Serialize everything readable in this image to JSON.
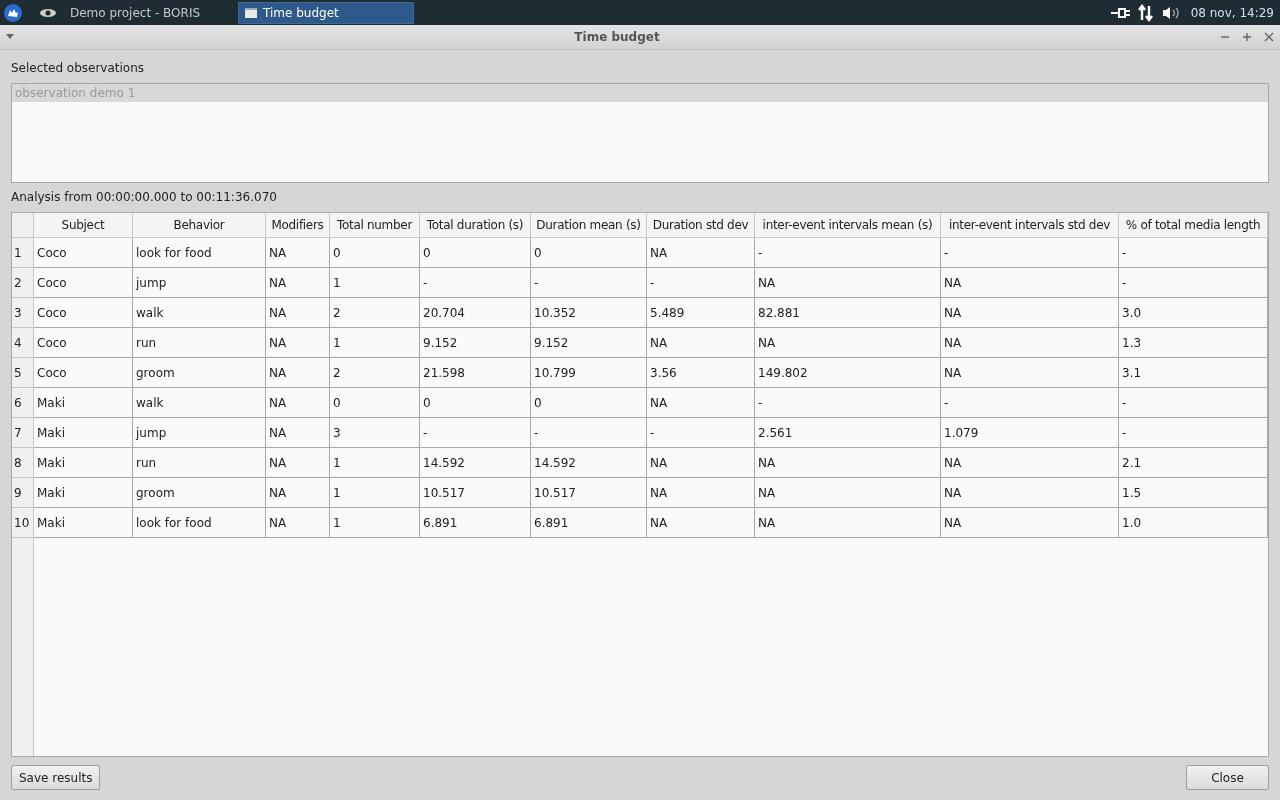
{
  "taskbar": {
    "apps": [
      {
        "label": "Demo project - BORIS",
        "selected": false
      },
      {
        "label": "Time budget",
        "selected": true
      }
    ],
    "clock": "08 nov, 14:29"
  },
  "window": {
    "title": "Time budget"
  },
  "observations": {
    "label": "Selected observations",
    "items": [
      {
        "label": "observation demo 1",
        "selected": true
      }
    ]
  },
  "analysis_label": "Analysis from 00:00:00.000 to 00:11:36.070",
  "table": {
    "columns": [
      "Subject",
      "Behavior",
      "Modifiers",
      "Total number",
      "Total duration (s)",
      "Duration mean (s)",
      "Duration std dev",
      "inter-event intervals mean (s)",
      "inter-event intervals std dev",
      "% of total media length"
    ],
    "rows": [
      {
        "index": "1",
        "cells": [
          "Coco",
          "look for food",
          "NA",
          "0",
          "0",
          "0",
          "NA",
          "-",
          "-",
          "-"
        ]
      },
      {
        "index": "2",
        "cells": [
          "Coco",
          "jump",
          "NA",
          "1",
          "-",
          "-",
          "-",
          "NA",
          "NA",
          "-"
        ]
      },
      {
        "index": "3",
        "cells": [
          "Coco",
          "walk",
          "NA",
          "2",
          "20.704",
          "10.352",
          "5.489",
          "82.881",
          "NA",
          "3.0"
        ]
      },
      {
        "index": "4",
        "cells": [
          "Coco",
          "run",
          "NA",
          "1",
          "9.152",
          "9.152",
          "NA",
          "NA",
          "NA",
          "1.3"
        ]
      },
      {
        "index": "5",
        "cells": [
          "Coco",
          "groom",
          "NA",
          "2",
          "21.598",
          "10.799",
          "3.56",
          "149.802",
          "NA",
          "3.1"
        ]
      },
      {
        "index": "6",
        "cells": [
          "Maki",
          "walk",
          "NA",
          "0",
          "0",
          "0",
          "NA",
          "-",
          "-",
          "-"
        ]
      },
      {
        "index": "7",
        "cells": [
          "Maki",
          "jump",
          "NA",
          "3",
          "-",
          "-",
          "-",
          "2.561",
          "1.079",
          "-"
        ]
      },
      {
        "index": "8",
        "cells": [
          "Maki",
          "run",
          "NA",
          "1",
          "14.592",
          "14.592",
          "NA",
          "NA",
          "NA",
          "2.1"
        ]
      },
      {
        "index": "9",
        "cells": [
          "Maki",
          "groom",
          "NA",
          "1",
          "10.517",
          "10.517",
          "NA",
          "NA",
          "NA",
          "1.5"
        ]
      },
      {
        "index": "10",
        "cells": [
          "Maki",
          "look for food",
          "NA",
          "1",
          "6.891",
          "6.891",
          "NA",
          "NA",
          "NA",
          "1.0"
        ]
      }
    ]
  },
  "buttons": {
    "save": "Save results",
    "close": "Close"
  }
}
